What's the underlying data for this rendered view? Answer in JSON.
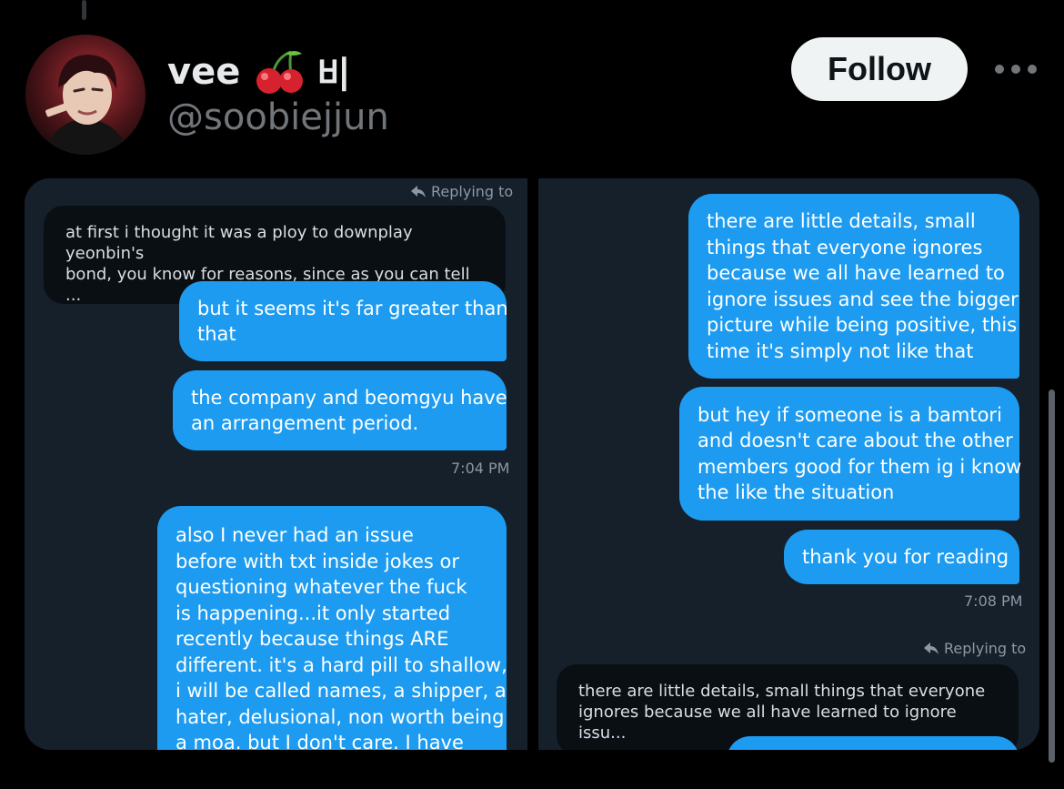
{
  "post": {
    "display_name": "vee",
    "emoji_icon": "cherry-icon",
    "name_suffix": "비",
    "handle": "@soobiejjun",
    "follow_label": "Follow",
    "more_icon": "more-dots-icon"
  },
  "colors": {
    "background": "#000000",
    "panel": "#15202b",
    "bubble": "#1d9bf0",
    "quote_bubble": "#0a0f14",
    "muted_text": "#8b98a5",
    "follow_bg": "#eff3f4"
  },
  "left_panel": {
    "replying_label": "Replying to",
    "quote_lines": [
      "at first i thought it was a ploy to downplay yeonbin's",
      "bond, you know for reasons, since as you can tell ..."
    ],
    "bubbles": [
      {
        "lines": [
          "but it seems it's far greater than",
          "that"
        ]
      },
      {
        "lines": [
          "the company and beomgyu have",
          "an arrangement period."
        ]
      },
      {
        "lines": [
          "also I never had an issue",
          "before with txt inside jokes or",
          "questioning whatever the fuck",
          "is happening...it only started",
          "recently because things ARE",
          "different. it's a hard pill to shallow,",
          "i will be called names, a shipper, a",
          "hater, delusional, non worth being",
          "a moa. but I don't care. I have"
        ]
      }
    ],
    "timestamp": "7:04 PM"
  },
  "right_panel": {
    "bubbles": [
      {
        "lines": [
          "there are little details, small",
          "things that everyone ignores",
          "because we all have learned to",
          "ignore issues and see the bigger",
          "picture while being positive, this",
          "time it's simply not like that"
        ]
      },
      {
        "lines": [
          "but hey if someone is a bamtori",
          "and doesn't care about the other",
          "members good for them ig i know",
          "the like the situation"
        ]
      },
      {
        "lines": [
          "thank you for reading"
        ]
      }
    ],
    "timestamp": "7:08 PM",
    "replying_label": "Replying to",
    "quote_lines": [
      "there are little details, small things that everyone",
      "ignores because we all have learned to ignore issu..."
    ]
  }
}
